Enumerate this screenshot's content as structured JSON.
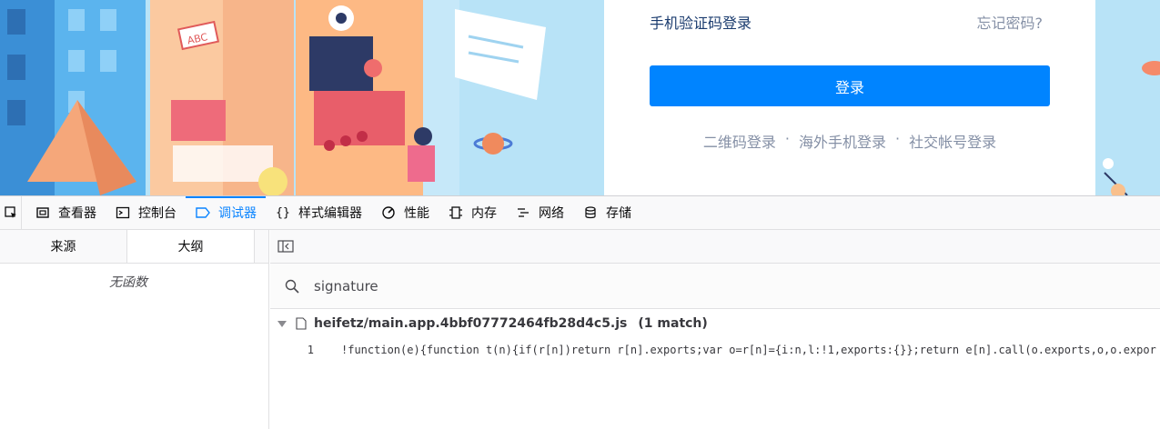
{
  "login": {
    "sms_login": "手机验证码登录",
    "forgot_password": "忘记密码?",
    "login_button": "登录",
    "alt": [
      "二维码登录",
      "海外手机登录",
      "社交帐号登录"
    ],
    "separator": "·"
  },
  "illustration": {
    "sign_text": "ABC"
  },
  "devtools": {
    "tools": [
      {
        "label": "查看器",
        "icon": "inspector-icon"
      },
      {
        "label": "控制台",
        "icon": "console-icon"
      },
      {
        "label": "调试器",
        "icon": "debugger-icon",
        "active": true
      },
      {
        "label": "样式编辑器",
        "icon": "style-editor-icon"
      },
      {
        "label": "性能",
        "icon": "performance-icon"
      },
      {
        "label": "内存",
        "icon": "memory-icon"
      },
      {
        "label": "网络",
        "icon": "network-icon"
      },
      {
        "label": "存储",
        "icon": "storage-icon"
      }
    ],
    "subtabs": [
      "来源",
      "大纲"
    ],
    "active_subtab": "大纲",
    "outline_empty": "无函数",
    "search_query": "signature",
    "result_file": "heifetz/main.app.4bbf07772464fb28d4c5.js",
    "result_count": "(1 match)",
    "result_line_number": "1",
    "result_line_text": "!function(e){function t(n){if(r[n])return r[n].exports;var o=r[n]={i:n,l:!1,exports:{}};return e[n].call(o.exports,o,o.expor",
    "accent": "#0a84ff"
  }
}
